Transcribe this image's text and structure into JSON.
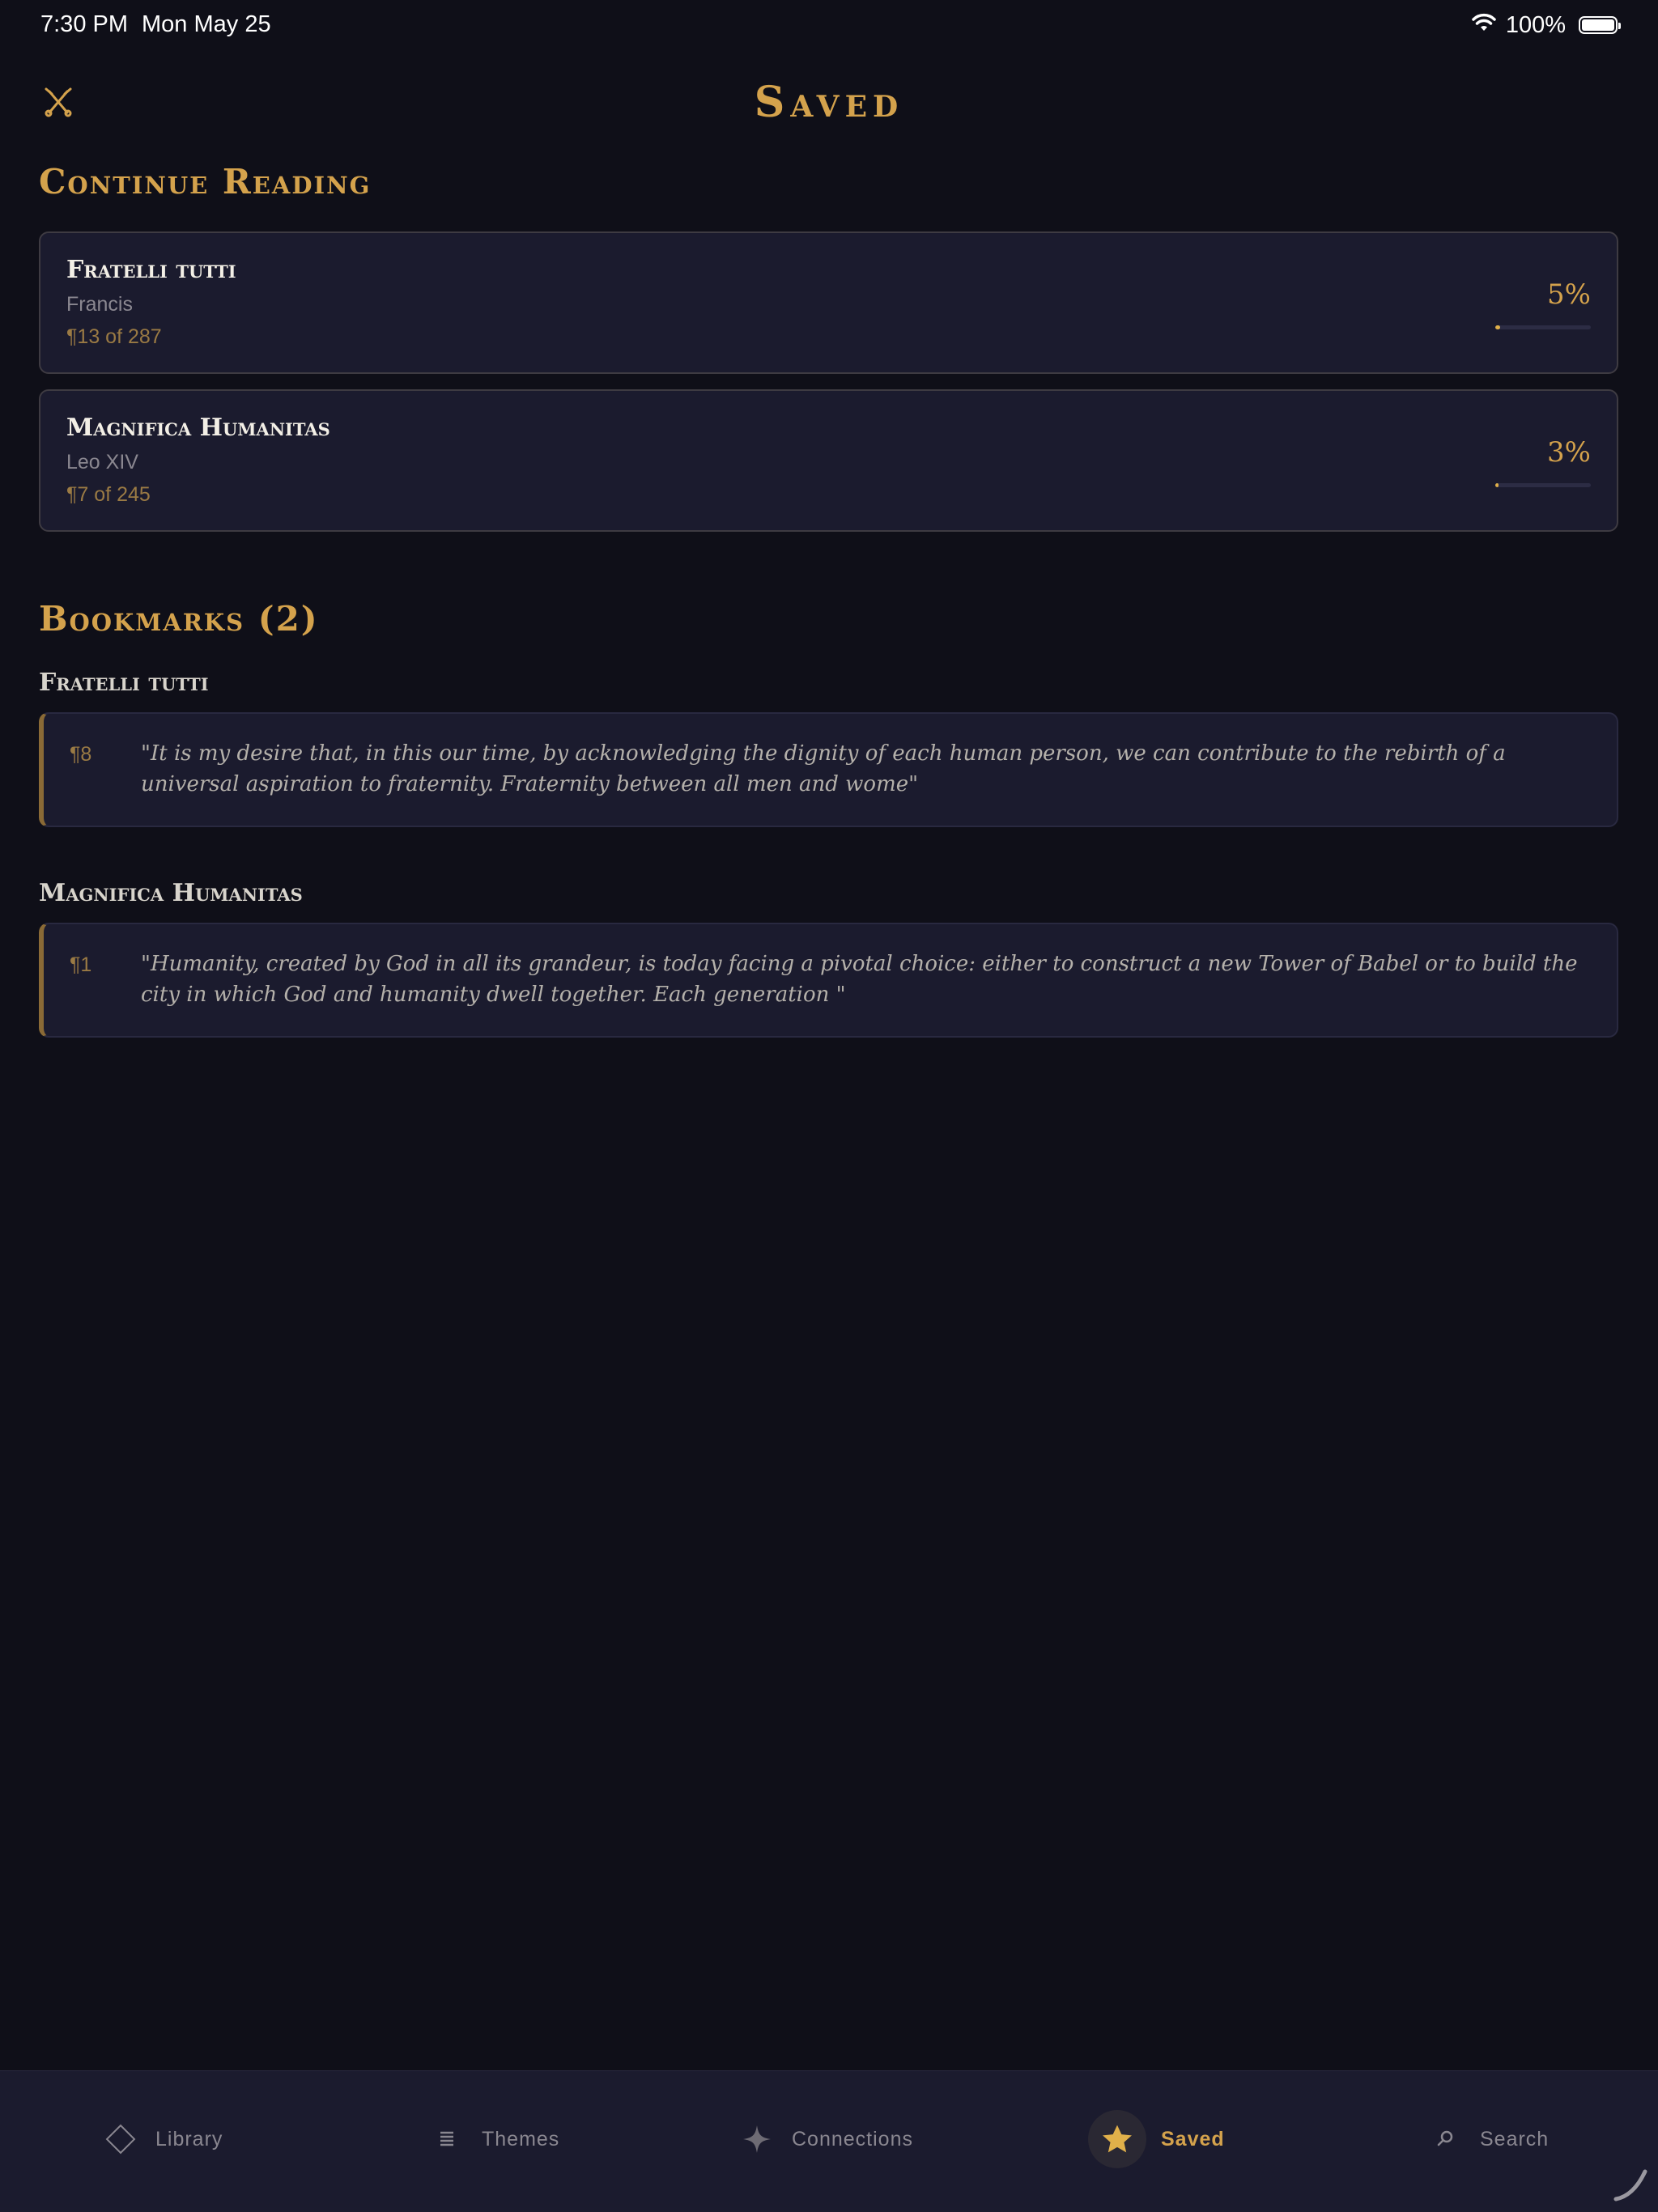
{
  "status_bar": {
    "time": "7:30 PM",
    "date": "Mon May 25",
    "battery": "100%"
  },
  "header": {
    "title": "Saved",
    "tool_icon": "crossed-tools-icon"
  },
  "continue_reading": {
    "title": "Continue Reading",
    "items": [
      {
        "title": "Fratelli tutti",
        "author": "Francis",
        "position": "¶13 of 287",
        "percent": "5%",
        "progress": 0.05
      },
      {
        "title": "Magnifica Humanitas",
        "author": "Leo XIV",
        "position": "¶7 of 245",
        "percent": "3%",
        "progress": 0.03
      }
    ]
  },
  "bookmarks": {
    "title": "Bookmarks (2)",
    "groups": [
      {
        "title": "Fratelli tutti",
        "items": [
          {
            "para": "¶8",
            "quote": "\"It is my desire that, in this our time, by acknowledging the dignity of each human person, we can contribute to the rebirth of a universal aspiration to fraternity. Fraternity between all men and wome\""
          }
        ]
      },
      {
        "title": "Magnifica Humanitas",
        "items": [
          {
            "para": "¶1",
            "quote": "\"Humanity, created by God in all its grandeur, is today facing a pivotal choice: either to construct a new Tower of Babel or to build the city in which God and humanity dwell together. Each generation \""
          }
        ]
      }
    ]
  },
  "tab_bar": {
    "tabs": [
      {
        "label": "Library",
        "icon": "diamond-icon",
        "active": false
      },
      {
        "label": "Themes",
        "icon": "lines-icon",
        "active": false
      },
      {
        "label": "Connections",
        "icon": "sparkle-icon",
        "active": false
      },
      {
        "label": "Saved",
        "icon": "star-icon",
        "active": true
      },
      {
        "label": "Search",
        "icon": "search-icon",
        "active": false
      }
    ]
  },
  "colors": {
    "background": "#0f0f18",
    "card": "#1b1b2e",
    "accent": "#d4a24c",
    "muted": "#8a8790"
  }
}
